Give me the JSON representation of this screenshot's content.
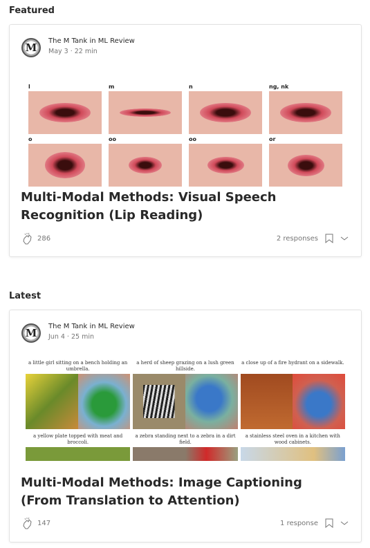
{
  "featured": {
    "section_label": "Featured",
    "author": "The M Tank in ML Review",
    "avatar_letter": "M",
    "meta": "May 3 · 22 min",
    "image_labels": [
      "l",
      "m",
      "n",
      "ng, nk",
      "o",
      "oo",
      "oo",
      "or"
    ],
    "title": "Multi-Modal Methods: Visual Speech Recognition (Lip Reading)",
    "claps": "286",
    "responses": "2 responses"
  },
  "latest": {
    "section_label": "Latest",
    "author": "The M Tank in ML Review",
    "avatar_letter": "M",
    "meta": "Jun 4 · 25 min",
    "captions": [
      "a little girl sitting on a bench holding an umbrella.",
      "a herd of sheep grazing on a lush green hillside.",
      "a close up of a fire hydrant on a sidewalk.",
      "a yellow plate topped with meat and broccoli.",
      "a zebra standing next to a zebra in a dirt field.",
      "a stainless steel oven in a kitchen with wood cabinets."
    ],
    "title": "Multi-Modal Methods: Image Captioning (From Translation to Attention)",
    "claps": "147",
    "responses": "1 response"
  }
}
